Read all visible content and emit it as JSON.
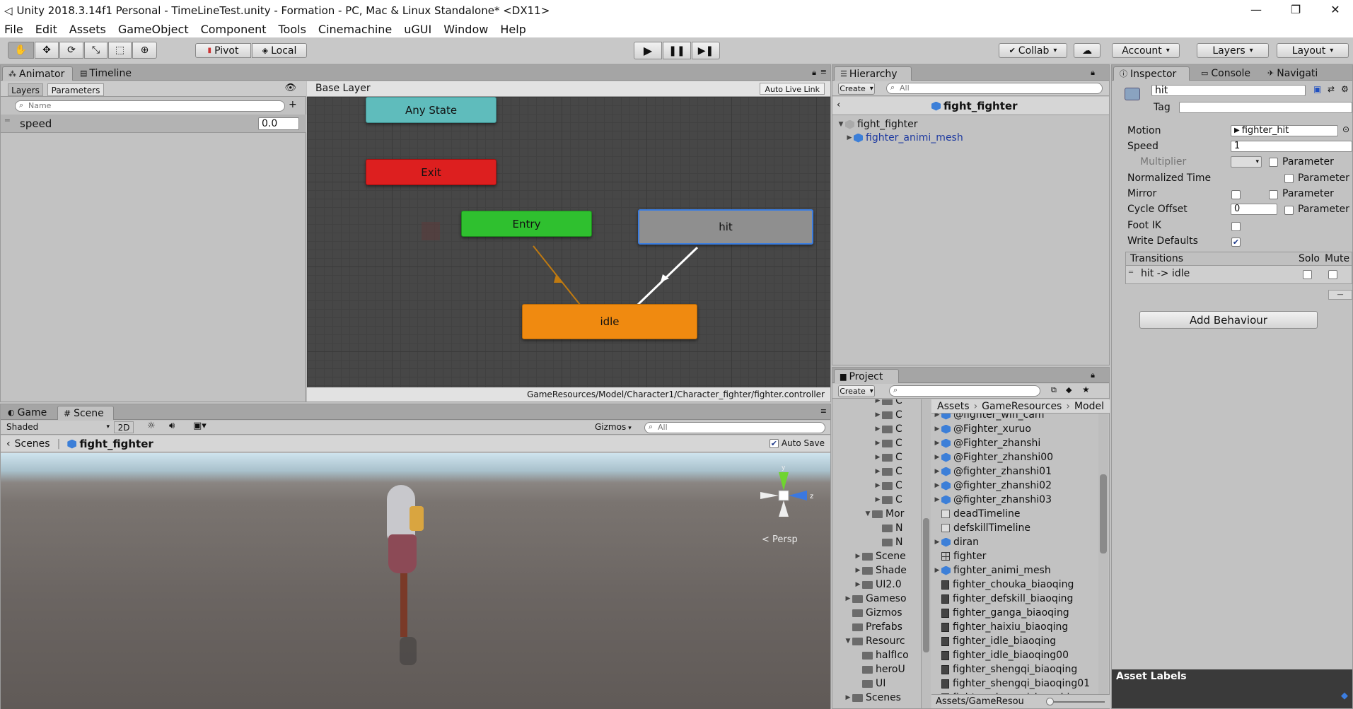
{
  "window": {
    "title": "Unity 2018.3.14f1 Personal - TimeLineTest.unity - Formation - PC, Mac & Linux Standalone* <DX11>",
    "minimize": "—",
    "maximize": "❐",
    "close": "✕"
  },
  "menu": [
    "File",
    "Edit",
    "Assets",
    "GameObject",
    "Component",
    "Tools",
    "Cinemachine",
    "uGUI",
    "Window",
    "Help"
  ],
  "toolbar": {
    "pivot": "Pivot",
    "local": "Local",
    "collab": "Collab",
    "account": "Account",
    "layers": "Layers",
    "layout": "Layout"
  },
  "animator": {
    "tabs": [
      "Animator",
      "Timeline"
    ],
    "subtabs": [
      "Layers",
      "Parameters"
    ],
    "search_placeholder": "Name",
    "param_name": "speed",
    "param_value": "0.0",
    "breadcrumb": "Base Layer",
    "auto_live_link": "Auto Live Link",
    "nodes": {
      "any_state": "Any State",
      "exit": "Exit",
      "entry": "Entry",
      "hit": "hit",
      "idle": "idle"
    },
    "path": "GameResources/Model/Character1/Character_fighter/fighter.controller"
  },
  "hierarchy": {
    "tab": "Hierarchy",
    "create": "Create",
    "search_placeholder": "All",
    "scene_title": "fight_fighter",
    "items": [
      "fight_fighter",
      "fighter_animi_mesh"
    ]
  },
  "inspector": {
    "tabs": [
      "Inspector",
      "Console",
      "Navigati"
    ],
    "name": "hit",
    "tag_label": "Tag",
    "motion_label": "Motion",
    "motion_value": "fighter_hit",
    "speed_label": "Speed",
    "speed_value": "1",
    "multiplier_label": "Multiplier",
    "parameter": "Parameter",
    "normalized_time_label": "Normalized Time",
    "mirror_label": "Mirror",
    "cycle_offset_label": "Cycle Offset",
    "cycle_offset_value": "0",
    "foot_ik_label": "Foot IK",
    "write_defaults_label": "Write Defaults",
    "transitions_label": "Transitions",
    "solo": "Solo",
    "mute": "Mute",
    "transition": "hit -> idle",
    "minus": "—",
    "add_behaviour": "Add Behaviour",
    "asset_labels": "Asset Labels"
  },
  "scene": {
    "tabs": [
      "Game",
      "Scene"
    ],
    "shading": "Shaded",
    "mode_2d": "2D",
    "gizmos": "Gizmos",
    "search_placeholder": "All",
    "breadcrumb_root": "Scenes",
    "breadcrumb_item": "fight_fighter",
    "auto_save": "Auto Save",
    "persp": "< Persp",
    "axis_y": "y",
    "axis_z": "z"
  },
  "project": {
    "tab": "Project",
    "create": "Create",
    "breadcrumb": [
      "Assets",
      "GameResources",
      "Model"
    ],
    "tree": [
      {
        "label": "C",
        "depth": 4,
        "arrow": "▶",
        "icon": "folder"
      },
      {
        "label": "C",
        "depth": 4,
        "arrow": "▶",
        "icon": "folder"
      },
      {
        "label": "C",
        "depth": 4,
        "arrow": "▶",
        "icon": "folder"
      },
      {
        "label": "C",
        "depth": 4,
        "arrow": "▶",
        "icon": "folder"
      },
      {
        "label": "C",
        "depth": 4,
        "arrow": "▶",
        "icon": "folder"
      },
      {
        "label": "C",
        "depth": 4,
        "arrow": "▶",
        "icon": "folder"
      },
      {
        "label": "C",
        "depth": 4,
        "arrow": "▶",
        "icon": "folder"
      },
      {
        "label": "C",
        "depth": 4,
        "arrow": "▶",
        "icon": "folder"
      },
      {
        "label": "Mor",
        "depth": 3,
        "arrow": "▼",
        "icon": "folder"
      },
      {
        "label": "N",
        "depth": 4,
        "arrow": "",
        "icon": "folder"
      },
      {
        "label": "N",
        "depth": 4,
        "arrow": "",
        "icon": "folder"
      },
      {
        "label": "Scene",
        "depth": 2,
        "arrow": "▶",
        "icon": "folder"
      },
      {
        "label": "Shade",
        "depth": 2,
        "arrow": "▶",
        "icon": "folder"
      },
      {
        "label": "UI2.0",
        "depth": 2,
        "arrow": "▶",
        "icon": "folder"
      },
      {
        "label": "Gameso",
        "depth": 1,
        "arrow": "▶",
        "icon": "folder"
      },
      {
        "label": "Gizmos",
        "depth": 1,
        "arrow": "",
        "icon": "folder"
      },
      {
        "label": "Prefabs",
        "depth": 1,
        "arrow": "",
        "icon": "folder"
      },
      {
        "label": "Resourc",
        "depth": 1,
        "arrow": "▼",
        "icon": "folder"
      },
      {
        "label": "halfIco",
        "depth": 2,
        "arrow": "",
        "icon": "folder"
      },
      {
        "label": "heroU",
        "depth": 2,
        "arrow": "",
        "icon": "folder"
      },
      {
        "label": "UI",
        "depth": 2,
        "arrow": "",
        "icon": "folder"
      },
      {
        "label": "Scenes",
        "depth": 1,
        "arrow": "▶",
        "icon": "folder"
      }
    ],
    "assets": [
      {
        "label": "@fighter_win_cam",
        "icon": "cube",
        "arrow": "▶"
      },
      {
        "label": "@Fighter_xuruo",
        "icon": "cube",
        "arrow": "▶"
      },
      {
        "label": "@Fighter_zhanshi",
        "icon": "cube",
        "arrow": "▶"
      },
      {
        "label": "@Fighter_zhanshi00",
        "icon": "cube",
        "arrow": "▶"
      },
      {
        "label": "@fighter_zhanshi01",
        "icon": "cube",
        "arrow": "▶"
      },
      {
        "label": "@fighter_zhanshi02",
        "icon": "cube",
        "arrow": "▶"
      },
      {
        "label": "@fighter_zhanshi03",
        "icon": "cube",
        "arrow": "▶"
      },
      {
        "label": "deadTimeline",
        "icon": "timeline",
        "arrow": ""
      },
      {
        "label": "defskillTimeline",
        "icon": "timeline",
        "arrow": ""
      },
      {
        "label": "diran",
        "icon": "cube",
        "arrow": "▶"
      },
      {
        "label": "fighter",
        "icon": "controller",
        "arrow": ""
      },
      {
        "label": "fighter_animi_mesh",
        "icon": "cube",
        "arrow": "▶"
      },
      {
        "label": "fighter_chouka_biaoqing",
        "icon": "clip",
        "arrow": ""
      },
      {
        "label": "fighter_defskill_biaoqing",
        "icon": "clip",
        "arrow": ""
      },
      {
        "label": "fighter_ganga_biaoqing",
        "icon": "clip",
        "arrow": ""
      },
      {
        "label": "fighter_haixiu_biaoqing",
        "icon": "clip",
        "arrow": ""
      },
      {
        "label": "fighter_idle_biaoqing",
        "icon": "clip",
        "arrow": ""
      },
      {
        "label": "fighter_idle_biaoqing00",
        "icon": "clip",
        "arrow": ""
      },
      {
        "label": "fighter_shengqi_biaoqing",
        "icon": "clip",
        "arrow": ""
      },
      {
        "label": "fighter_shengqi_biaoqing01",
        "icon": "clip",
        "arrow": ""
      },
      {
        "label": "fighter_shengqi_loop_biaoq",
        "icon": "clip",
        "arrow": ""
      }
    ],
    "footer_path": "Assets/GameResou"
  },
  "colors": {
    "any_state": "#5fbcbc",
    "exit": "#dd1f1f",
    "entry": "#2fc02f",
    "hit": "#8f8f8f",
    "idle": "#f08a10",
    "selection": "#3b7de0"
  }
}
